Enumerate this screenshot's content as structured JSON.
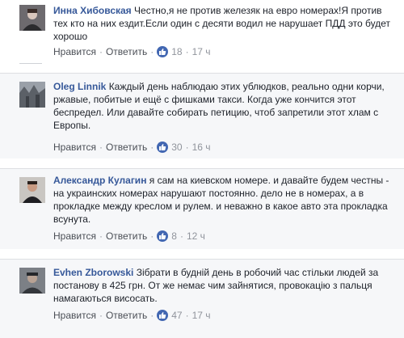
{
  "comments": [
    {
      "author": "Инна Хибовская",
      "text": "Честно,я не против железяк на евро номерах!Я против тех кто на них ездит.Если один с десяти водил не нарушает ПДД это будет хорошо",
      "like_label": "Нравится",
      "reply_label": "Ответить",
      "likes": "18",
      "time": "17 ч"
    },
    {
      "author": "Oleg Linnik",
      "text": "Каждый день наблюдаю этих ублюдков, реально одни корчи, ржавые, побитые и ещё с фишками такси. Когда уже кончится этот беспредел. Или давайте собирать петицию, чтоб запретили этот хлам с Европы.",
      "like_label": "Нравится",
      "reply_label": "Ответить",
      "likes": "30",
      "time": "16 ч"
    },
    {
      "author": "Александр Кулагин",
      "text": "я сам на киевском номере. и давайте будем честны - на украинских номерах нарушают постоянно. дело не в номерах, а в прокладке между креслом и рулем. и неважно в какое авто эта прокладка всунута.",
      "like_label": "Нравится",
      "reply_label": "Ответить",
      "likes": "8",
      "time": "12 ч"
    },
    {
      "author": "Evhen Zborowski",
      "text": "Зібрати в будній день в робочий час стільки людей за постанову в 425 грн. От же немає чим зайнятися, провокацію з пальця намагаються висосать.",
      "like_label": "Нравится",
      "reply_label": "Ответить",
      "likes": "47",
      "time": "17 ч"
    }
  ],
  "icons": {
    "like": "thumbs-up-icon"
  },
  "colors": {
    "author": "#365899",
    "meta": "#90949c",
    "like_badge": "#4267b2",
    "panel_bg": "#f6f7f9"
  }
}
